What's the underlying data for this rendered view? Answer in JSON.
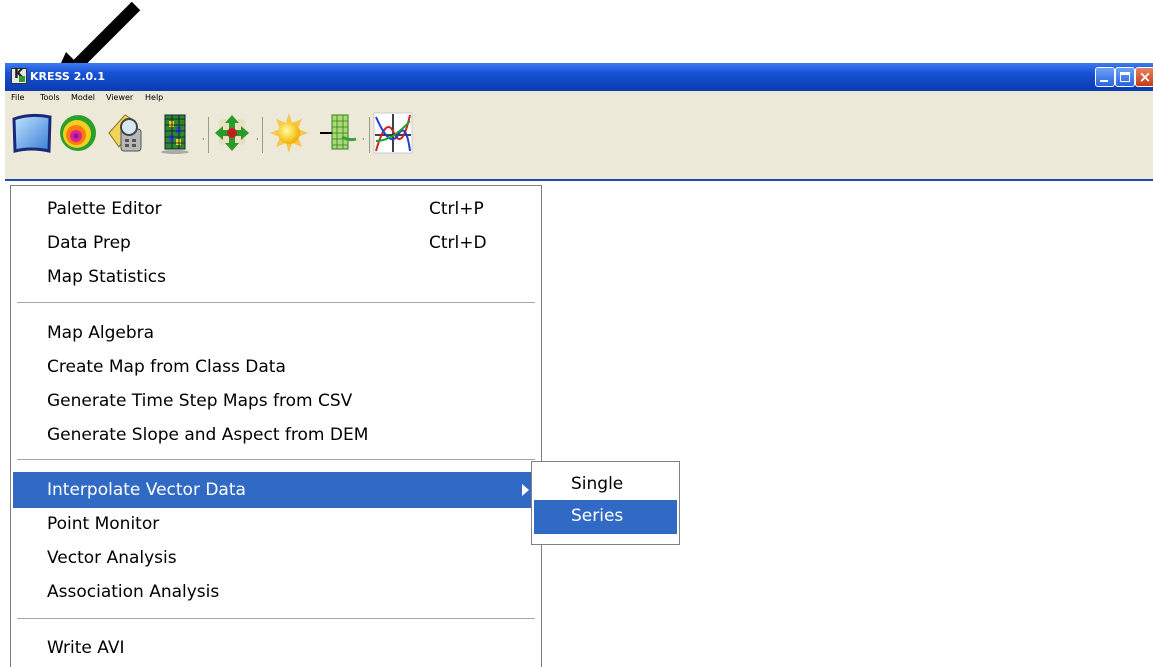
{
  "window": {
    "title": "KRESS 2.0.1",
    "controls": [
      "minimize",
      "maximize",
      "close"
    ]
  },
  "menubar": {
    "items": [
      "File",
      "Tools",
      "Model",
      "Viewer",
      "Help"
    ]
  },
  "toolbar": {
    "buttons": [
      "blank-map-icon",
      "spiral-map-icon",
      "palette-calculator-icon",
      "grid-map-icon",
      "recycle-arrows-icon",
      "sun-icon",
      "grid-arrow-icon",
      "curves-graph-icon"
    ]
  },
  "tools_menu": {
    "items": [
      {
        "label": "Palette Editor",
        "shortcut": "Ctrl+P"
      },
      {
        "label": "Data Prep",
        "shortcut": "Ctrl+D"
      },
      {
        "label": "Map Statistics",
        "shortcut": ""
      },
      {
        "label": "Map Algebra",
        "shortcut": ""
      },
      {
        "label": "Create Map from Class Data",
        "shortcut": ""
      },
      {
        "label": "Generate Time Step Maps from CSV",
        "shortcut": ""
      },
      {
        "label": "Generate Slope and Aspect from DEM",
        "shortcut": ""
      },
      {
        "label": "Interpolate Vector Data",
        "shortcut": "",
        "has_submenu": true,
        "highlighted": true
      },
      {
        "label": "Point Monitor",
        "shortcut": ""
      },
      {
        "label": "Vector Analysis",
        "shortcut": ""
      },
      {
        "label": "Association Analysis",
        "shortcut": ""
      },
      {
        "label": "Write AVI",
        "shortcut": ""
      }
    ]
  },
  "submenu": {
    "items": [
      {
        "label": "Single",
        "highlighted": false
      },
      {
        "label": "Series",
        "highlighted": true
      }
    ]
  },
  "colors": {
    "highlight": "#316ac5",
    "titlebar": "#0f45c2",
    "toolbar_bg": "#ece9d8"
  },
  "annotation": {
    "arrow": "black-pointer-arrow-icon"
  }
}
